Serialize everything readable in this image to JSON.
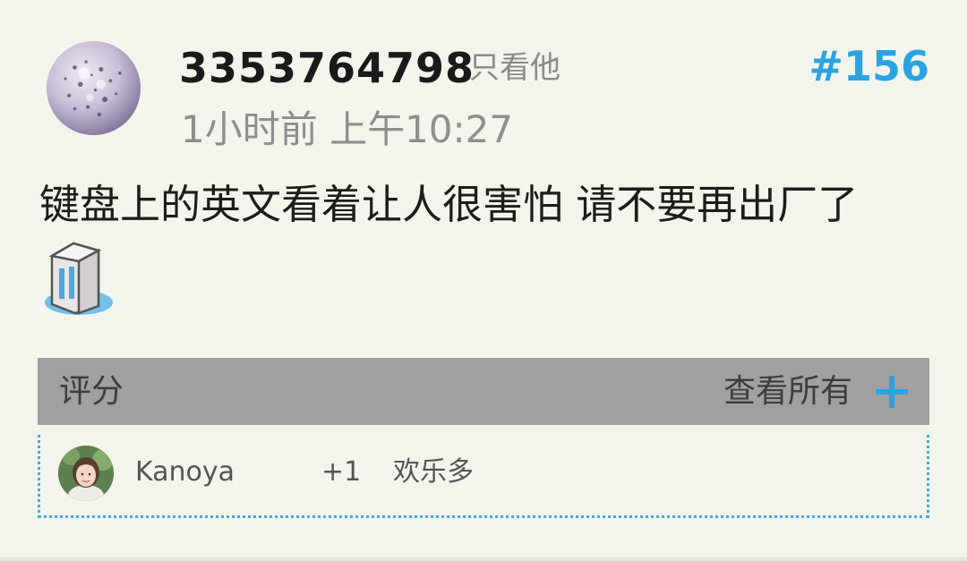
{
  "post": {
    "username": "3353764798",
    "only_him_label": "只看他",
    "floor_number": "#156",
    "time": "1小时前 上午10:27",
    "content": "键盘上的英文看着让人很害怕 请不要再出厂了",
    "emoji_icon": "sweat-drop-emoji-icon"
  },
  "rating": {
    "label": "评分",
    "view_all_label": "查看所有",
    "plus_icon": "plus-icon",
    "entries": [
      {
        "name": "Kanoya",
        "score": "+1",
        "reason": "欢乐多"
      }
    ]
  },
  "colors": {
    "accent": "#2aa3e0",
    "background": "#f3f5ec",
    "rating_bar": "#a0a0a0",
    "dotted_border": "#4aa8d8"
  }
}
